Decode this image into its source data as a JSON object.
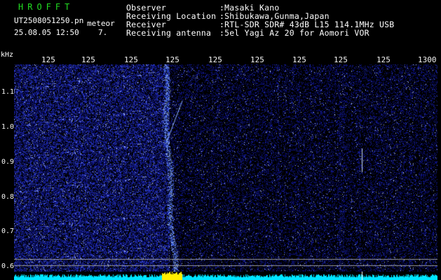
{
  "station": {
    "brand": "HROFFT",
    "filename": "UT2508051250.pn",
    "mode": "meteor",
    "date": "25.08.05",
    "time": "12:50",
    "count": "7."
  },
  "info": [
    {
      "label": "Observer",
      "value": ":Masaki Kano"
    },
    {
      "label": "Receiving Location",
      "value": ":Shibukawa,Gunma,Japan"
    },
    {
      "label": "Receiver",
      "value": ":RTL-SDR SDR# 43dB L15 114.1MHz USB"
    },
    {
      "label": "Receiving antenna",
      "value": ":5el Yagi Az 20 for Aomori VOR"
    }
  ],
  "axes": {
    "y_unit": "kHz",
    "y_ticks": [
      "1.1",
      "1.0",
      "0.9",
      "0.8",
      "0.7",
      "0.6"
    ],
    "x_ticks": [
      "125",
      "125",
      "125",
      "125",
      "125",
      "125",
      "125",
      "125",
      "125",
      "1300"
    ]
  },
  "colors": {
    "background": "#000000",
    "brand": "#22dd22",
    "noise": "#2a3cff",
    "signal": "#aaccff",
    "scope": "#00e5ff",
    "scope_hot": "#ffee00"
  }
}
